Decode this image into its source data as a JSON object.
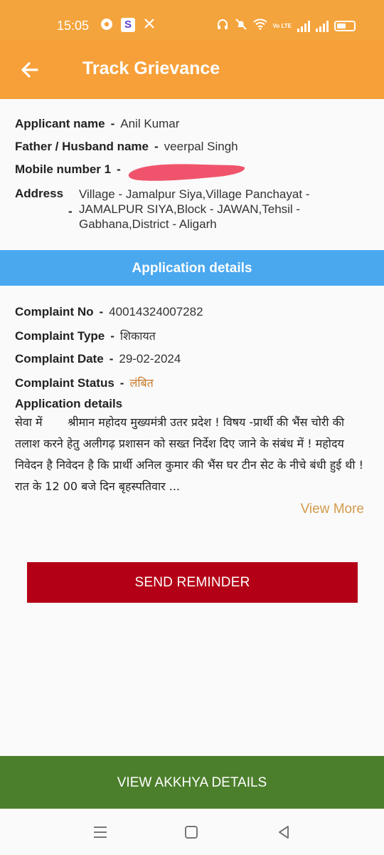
{
  "status_bar": {
    "time": "15:05",
    "volte_label": "Vo LTE"
  },
  "app_bar": {
    "title": "Track Grievance"
  },
  "applicant": {
    "name_label": "Applicant name",
    "name_value": "Anil Kumar",
    "father_label": "Father / Husband name",
    "father_value": "veerpal Singh",
    "mobile_label": "Mobile number 1",
    "address_label": "Address",
    "address_value": "Village - Jamalpur Siya,Village Panchayat - JAMALPUR SIYA,Block - JAWAN,Tehsil - Gabhana,District - Aligarh",
    "separator": "-"
  },
  "section": {
    "title": "Application details"
  },
  "complaint": {
    "no_label": "Complaint No",
    "no_value": "40014324007282",
    "type_label": "Complaint Type",
    "type_value": "शिकायत",
    "date_label": "Complaint Date",
    "date_value": "29-02-2024",
    "status_label": "Complaint Status",
    "status_value": "लंबित",
    "details_label": "Application details",
    "details_text": "सेवा में       श्रीमान महोदय मुख्यमंत्री उतर प्रदेश ! विषय -प्रार्थी की भैंस चोरी की तलाश करने हेतु अलीगढ़ प्रशासन को सख्त निर्देश दिए जाने के संबंध में ! महोदय    निवेदन है निवेदन है कि प्रार्थी अनिल कुमार की भैंस घर टीन सेट के नीचे बंधी हुई थी ! रात के 12 00 बजे दिन बृहस्पतिवार ..."
  },
  "actions": {
    "view_more": "View More",
    "send_reminder": "SEND REMINDER",
    "view_akkhya": "VIEW AKKHYA DETAILS"
  },
  "colors": {
    "app_bar": "#f7a03a",
    "section_bar": "#4aa8ef",
    "reminder_button": "#b40016",
    "akkhya_button": "#4c7f2c",
    "status_pending": "#c77a2a"
  }
}
